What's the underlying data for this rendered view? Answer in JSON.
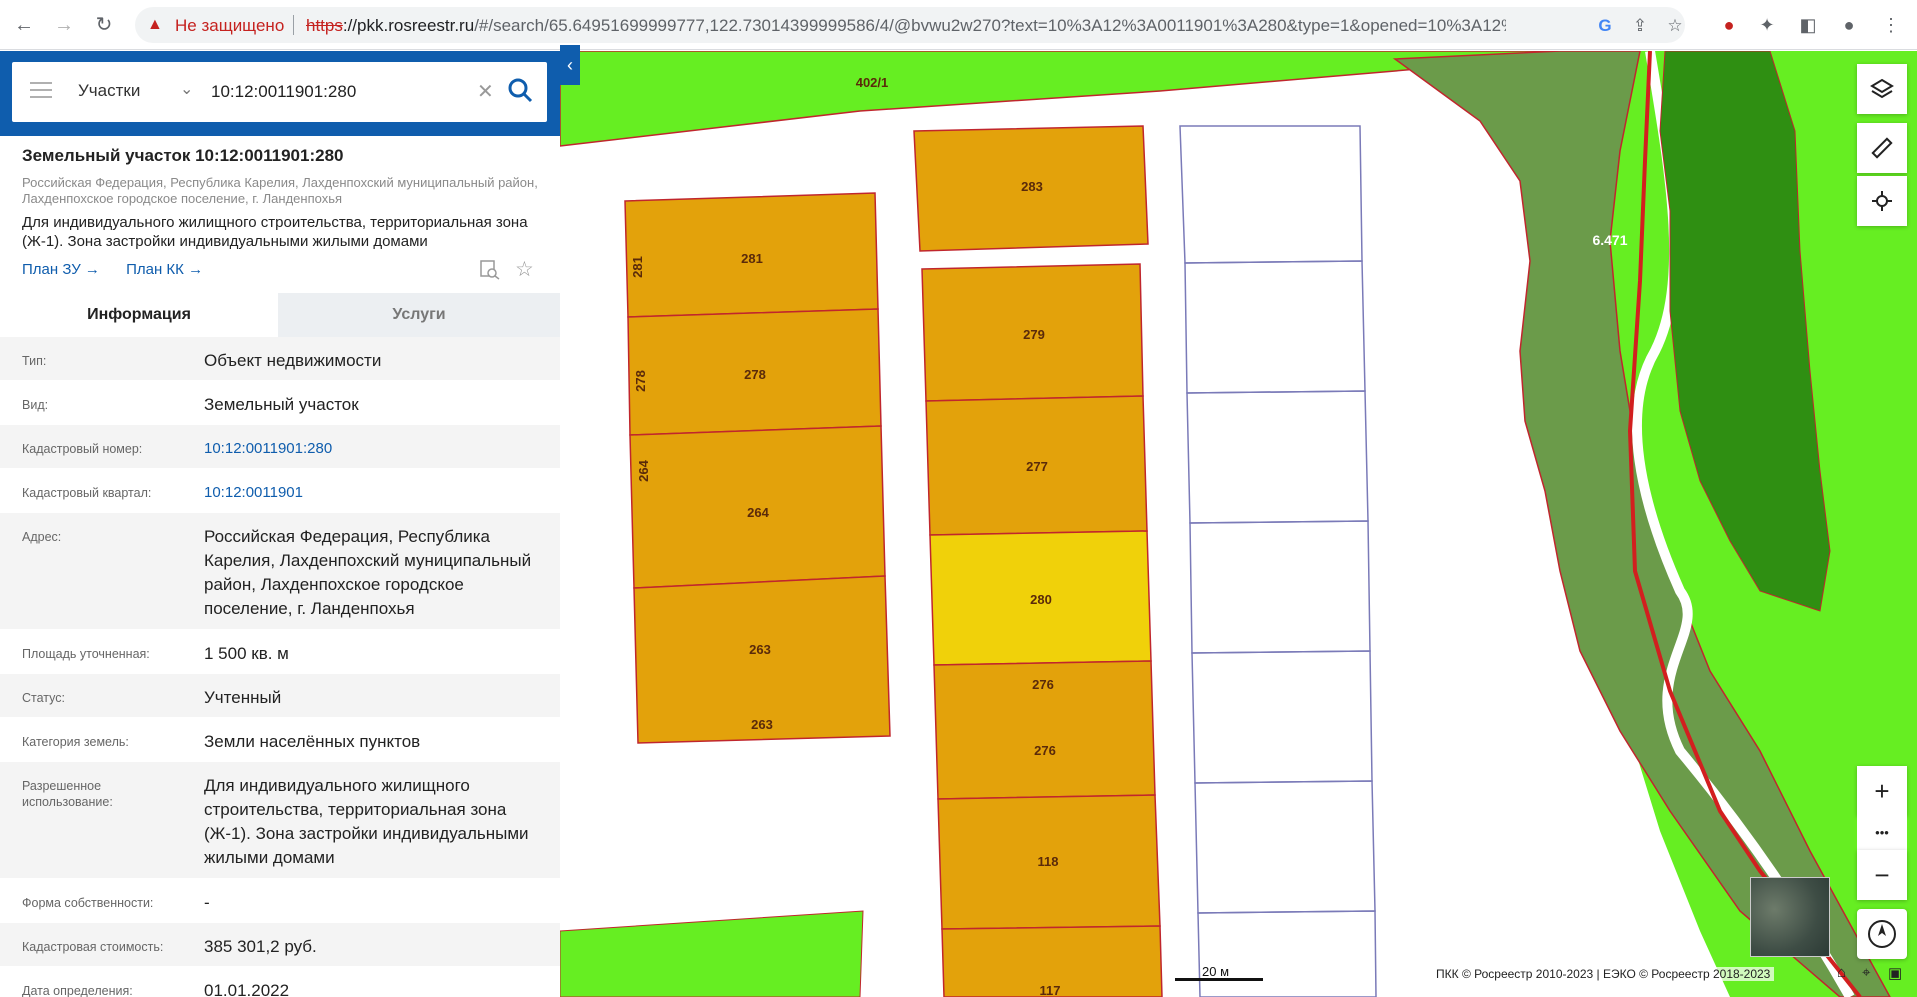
{
  "browser": {
    "security_label": "Не защищено",
    "url_scheme": "https",
    "url_host": "://pkk.rosreestr.ru",
    "url_rest": "/#/search/65.64951699999777,122.73014399999586/4/@bvwu2w270?text=10%3A12%3A0011901%3A280&type=1&opened=10%3A12%3..."
  },
  "search": {
    "layer_type": "Участки",
    "query": "10:12:0011901:280"
  },
  "object": {
    "title": "Земельный участок 10:12:0011901:280",
    "address_short": "Российская Федерация, Республика Карелия, Лахденпохский муниципальный район, Лахденпохское городское поселение, г. Ланденпохья",
    "usage_short": "Для индивидуального жилищного строительства, территориальная зона (Ж-1). Зона застройки индивидуальными жилыми домами",
    "links": [
      "План ЗУ →",
      "План КК →"
    ]
  },
  "tabs": [
    "Информация",
    "Услуги"
  ],
  "rows": [
    {
      "label": "Тип:",
      "value": "Объект недвижимости"
    },
    {
      "label": "Вид:",
      "value": "Земельный участок"
    },
    {
      "label": "Кадастровый номер:",
      "value": "10:12:0011901:280"
    },
    {
      "label": "Кадастровый квартал:",
      "value": "10:12:0011901"
    },
    {
      "label": "Адрес:",
      "value": "Российская Федерация, Республика Карелия, Лахденпохский муниципальный район, Лахденпохское городское поселение, г. Ланденпохья"
    },
    {
      "label": "Площадь уточненная:",
      "value": "1 500 кв. м"
    },
    {
      "label": "Статус:",
      "value": "Учтенный"
    },
    {
      "label": "Категория земель:",
      "value": "Земли населённых пунктов"
    },
    {
      "label": "Разрешенное использование:",
      "value": "Для индивидуального жилищного строительства, территориальная зона (Ж-1). Зона застройки индивидуальными жилыми домами"
    },
    {
      "label": "Форма собственности:",
      "value": "-"
    },
    {
      "label": "Кадастровая стоимость:",
      "value": "385 301,2 руб."
    },
    {
      "label": "Дата определения:",
      "value": "01.01.2022"
    }
  ],
  "map": {
    "parcel_labels": {
      "p281": "281",
      "p281_side": "281",
      "p278": "278",
      "p278_side": "278",
      "p264": "264",
      "p264_side": "264",
      "p263": "263",
      "p263_b": "263",
      "p283": "283",
      "p279": "279",
      "p277": "277",
      "p280": "280",
      "p276": "276",
      "p276_b": "276",
      "p118": "118",
      "p117": "117",
      "p402": "402/1",
      "p6471": "6.471"
    },
    "scale_label": "20 м",
    "attribution": "ПКК © Росреестр 2010-2023 | ЕЭКО © Росреестр 2018-2023",
    "zoom_in": "+",
    "zoom_more": "•••",
    "zoom_out": "−"
  },
  "colors": {
    "brand": "#0f5dad",
    "parcel": "#e3a20b",
    "parcel_selected": "#f0d10a",
    "parcel_border": "#c0262d",
    "green_light": "#66ee22",
    "green_dark": "#2f8f12",
    "green_mid": "#6b9b4a"
  }
}
